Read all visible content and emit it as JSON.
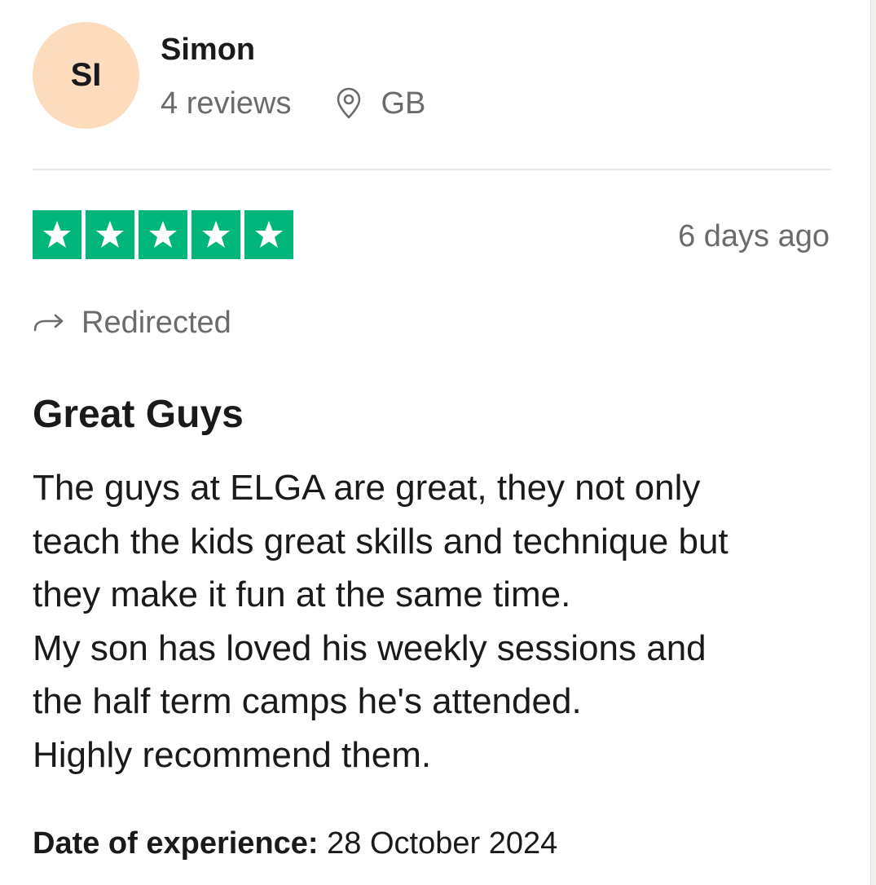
{
  "reviewer": {
    "initials": "SI",
    "name": "Simon",
    "review_count": "4 reviews",
    "location": "GB",
    "avatar_color": "#fddcbd"
  },
  "rating": {
    "stars": 5,
    "max_stars": 5,
    "star_color": "#00b67a"
  },
  "review": {
    "posted": "6 days ago",
    "source_label": "Redirected",
    "title": "Great Guys",
    "body_lines": [
      "The guys at ELGA are great, they not only",
      "teach the kids great skills and technique but",
      "they make it fun at the same time.",
      "My son has loved his weekly sessions and",
      "the half term camps he's attended.",
      "Highly recommend them."
    ],
    "experience_label": "Date of experience:",
    "experience_date": "28 October 2024"
  }
}
